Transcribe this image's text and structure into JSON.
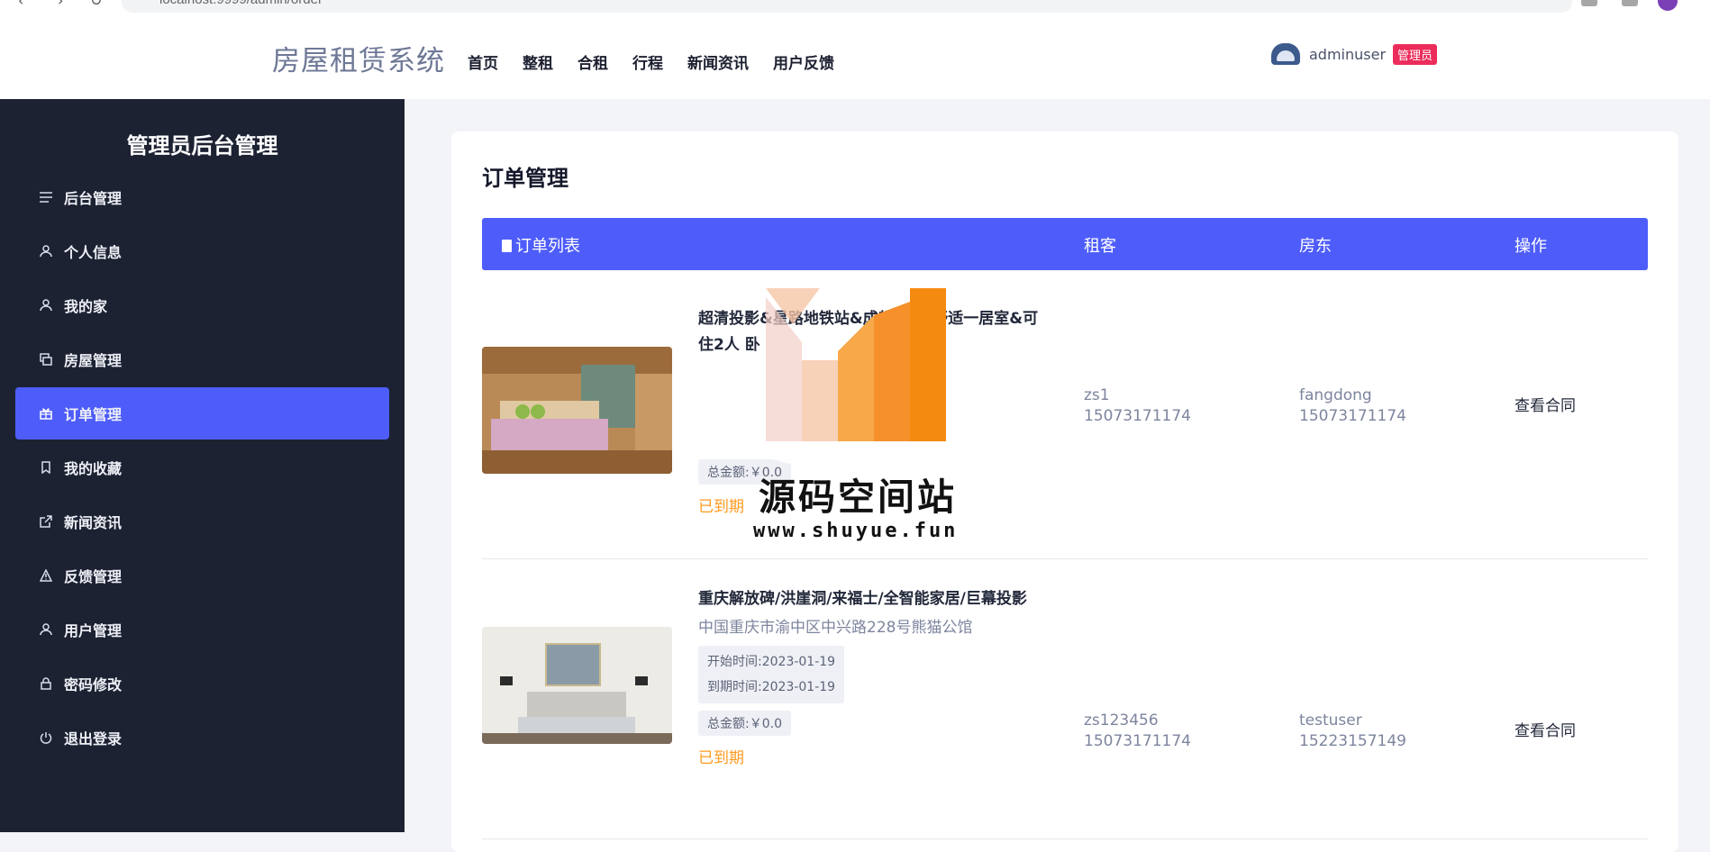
{
  "browser": {
    "url": "localhost:9999/admin/order"
  },
  "header": {
    "brand": "房屋租赁系统",
    "nav": [
      "首页",
      "整租",
      "合租",
      "行程",
      "新闻资讯",
      "用户反馈"
    ],
    "username": "adminuser",
    "role_badge": "管理员"
  },
  "sidebar": {
    "title": "管理员后台管理",
    "items": [
      {
        "label": "后台管理",
        "icon": "list-icon"
      },
      {
        "label": "个人信息",
        "icon": "user-icon"
      },
      {
        "label": "我的家",
        "icon": "user-icon"
      },
      {
        "label": "房屋管理",
        "icon": "copy-icon"
      },
      {
        "label": "订单管理",
        "icon": "gift-icon",
        "active": true
      },
      {
        "label": "我的收藏",
        "icon": "bookmark-icon"
      },
      {
        "label": "新闻资讯",
        "icon": "external-link-icon"
      },
      {
        "label": "反馈管理",
        "icon": "alert-triangle-icon"
      },
      {
        "label": "用户管理",
        "icon": "user-icon"
      },
      {
        "label": "密码修改",
        "icon": "lock-icon"
      },
      {
        "label": "退出登录",
        "icon": "power-icon"
      }
    ]
  },
  "main": {
    "title": "订单管理",
    "table_headers": {
      "list": "订单列表",
      "tenant": "租客",
      "landlord": "房东",
      "ops": "操作"
    },
    "orders": [
      {
        "title": "超清投影&星路地铁站&成都3室&舒适一居室&可住2人 卧",
        "amount": "总金额:￥0.0",
        "status": "已到期",
        "tenant_name": "zs1",
        "tenant_phone": "15073171174",
        "landlord_name": "fangdong",
        "landlord_phone": "15073171174",
        "action": "查看合同"
      },
      {
        "title": "重庆解放碑/洪崖洞/来福士/全智能家居/巨幕投影",
        "address": "中国重庆市渝中区中兴路228号熊猫公馆",
        "start": "开始时间:2023-01-19",
        "end": "到期时间:2023-01-19",
        "amount": "总金额:￥0.0",
        "status": "已到期",
        "tenant_name": "zs123456",
        "tenant_phone": "15073171174",
        "landlord_name": "testuser",
        "landlord_phone": "15223157149",
        "action": "查看合同"
      }
    ]
  },
  "watermark": {
    "text": "源码空间站",
    "url": "www.shuyue.fun"
  }
}
